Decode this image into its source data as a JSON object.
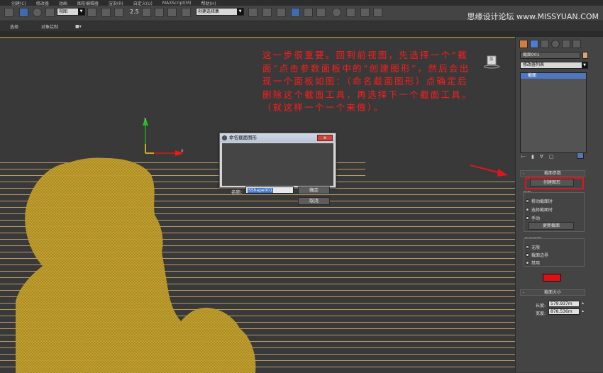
{
  "menu": {
    "items": [
      "创建(C)",
      "修改器",
      "动画",
      "图形编辑器",
      "渲染(R)",
      "自定义(U)",
      "MAXScript(M)",
      "帮助(H)"
    ],
    "watermark": "思缘设计论坛 www.MISSYUAN.COM"
  },
  "toolbar": {
    "view_dropdown": "视图",
    "snap_label": "2.5",
    "selection_set_dropdown": "创建选择集"
  },
  "ribbon": {
    "tabs": [
      "选择",
      "对象绘制"
    ]
  },
  "viewport": {
    "annotation": "这一步很重要。回到前视图，先选择一个“截面”点击参数面板中的“创建图形”，然后会出现一个面板如图：（命名截面图形）点确定后删除这个截面工具，再选择下一个截面工具。（就这样一个一个来做）。",
    "axis_y": "y",
    "axis_x": "x",
    "viewcube_label": "前"
  },
  "dialog": {
    "title": "命名截面图形",
    "name_label": "名称:",
    "name_value": "SShape001",
    "ok": "确定",
    "cancel": "取消",
    "close": "x"
  },
  "command_panel": {
    "object_name": "截面001",
    "modifier_list": "修改器列表",
    "stack_item": "截面",
    "section_params": {
      "title": "截面参数",
      "create_shape": "创建图形",
      "update_label": "更新:",
      "update_options": [
        "移动截面时",
        "选择截面时",
        "手动"
      ],
      "update_button": "更新截面",
      "extent_title": "截面范围",
      "extent_options": [
        "无限",
        "截面边界",
        "禁用"
      ],
      "color": "#e01010"
    },
    "section_size": {
      "title": "截面大小",
      "length_label": "长度:",
      "length_value": "579.937m",
      "width_label": "宽度:",
      "width_value": "878.536m"
    }
  },
  "colors": {
    "annotation_red": "#ff1c1c",
    "highlight_red": "#e0141f",
    "figure_yellow": "#c9a42b",
    "selection_blue": "#4e77c2"
  }
}
